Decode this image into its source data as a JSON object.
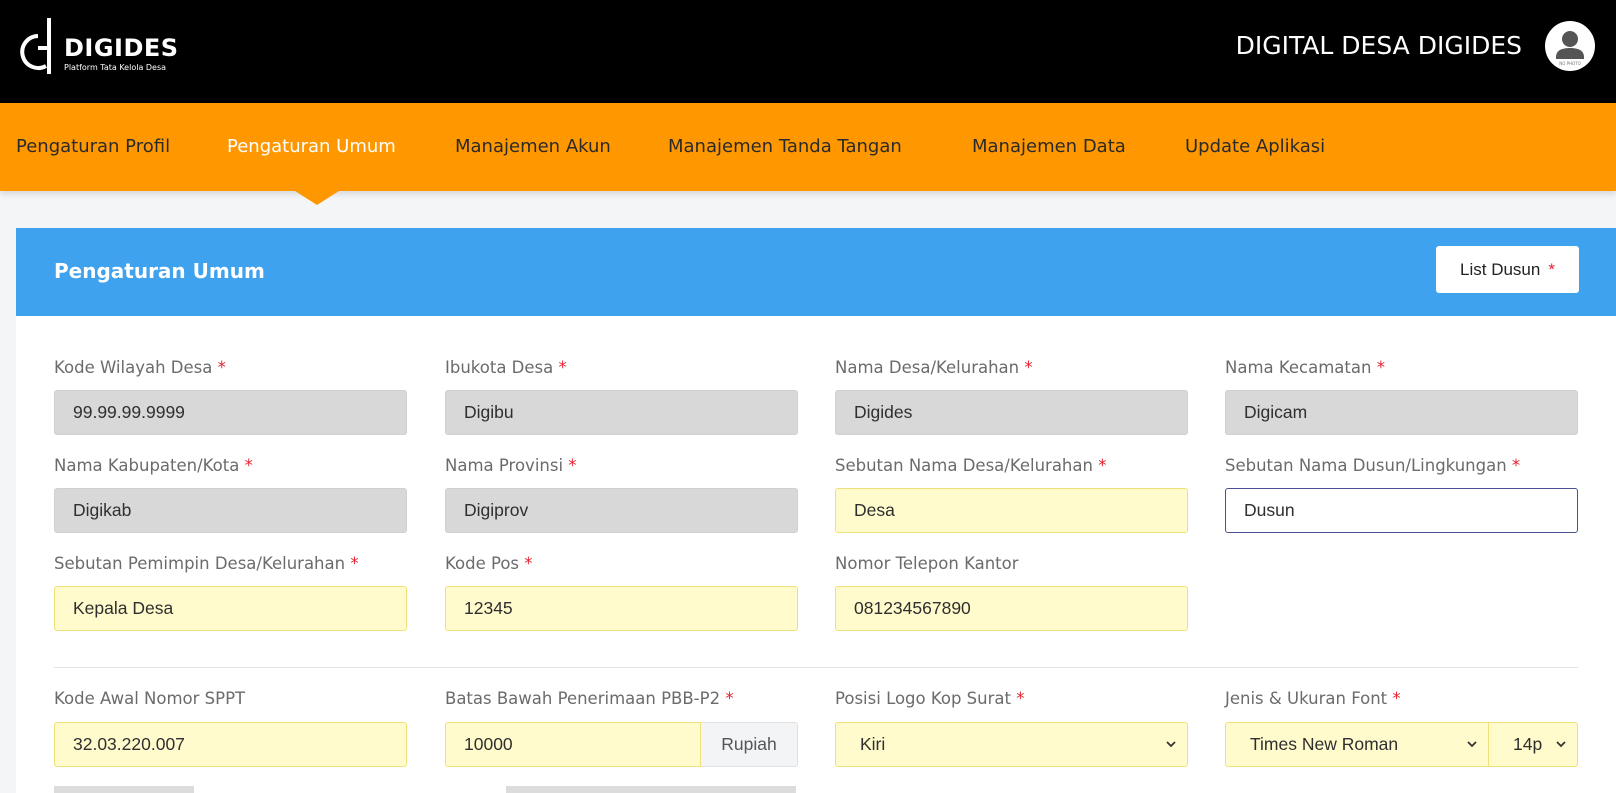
{
  "header": {
    "brand": "DIGIDES",
    "tagline": "Platform Tata Kelola Desa",
    "app_title": "DIGITAL DESA DIGIDES",
    "avatar_caption": "NO PHOTO"
  },
  "nav": {
    "items": [
      {
        "label": "Pengaturan Profil",
        "active": false
      },
      {
        "label": "Pengaturan Umum",
        "active": true
      },
      {
        "label": "Manajemen Akun",
        "active": false
      },
      {
        "label": "Manajemen Tanda Tangan",
        "active": false
      },
      {
        "label": "Manajemen Data",
        "active": false
      },
      {
        "label": "Update Aplikasi",
        "active": false
      }
    ]
  },
  "card": {
    "title": "Pengaturan Umum",
    "list_button": "List Dusun",
    "required_mark": "*"
  },
  "fields": {
    "kode_wilayah": {
      "label": "Kode Wilayah Desa",
      "value": "99.99.99.9999"
    },
    "ibukota": {
      "label": "Ibukota Desa",
      "value": "Digibu"
    },
    "nama_desa": {
      "label": "Nama Desa/Kelurahan",
      "value": "Digides"
    },
    "nama_kecamatan": {
      "label": "Nama Kecamatan",
      "value": "Digicam"
    },
    "nama_kabupaten": {
      "label": "Nama Kabupaten/Kota",
      "value": "Digikab"
    },
    "nama_provinsi": {
      "label": "Nama Provinsi",
      "value": "Digiprov"
    },
    "sebutan_desa": {
      "label": "Sebutan Nama Desa/Kelurahan",
      "value": "Desa"
    },
    "sebutan_dusun": {
      "label": "Sebutan Nama Dusun/Lingkungan",
      "value": "Dusun"
    },
    "sebutan_pemimpin": {
      "label": "Sebutan Pemimpin Desa/Kelurahan",
      "value": "Kepala Desa"
    },
    "kode_pos": {
      "label": "Kode Pos",
      "value": "12345"
    },
    "telepon": {
      "label": "Nomor Telepon Kantor",
      "value": "081234567890"
    },
    "kode_sppt": {
      "label": "Kode Awal Nomor SPPT",
      "value": "32.03.220.007"
    },
    "batas_pbb": {
      "label": "Batas Bawah Penerimaan PBB-P2",
      "value": "10000",
      "addon": "Rupiah"
    },
    "posisi_logo": {
      "label": "Posisi Logo Kop Surat",
      "value": "Kiri"
    },
    "font": {
      "label": "Jenis & Ukuran Font",
      "value": "Times New Roman",
      "size_value": "14p"
    }
  },
  "colors": {
    "topbar": "#000000",
    "nav": "#ff9800",
    "card_header": "#3fa2ee",
    "required": "#e5202f",
    "readonly_field": "#d8d8d8",
    "editable_field": "#fffbcc"
  }
}
